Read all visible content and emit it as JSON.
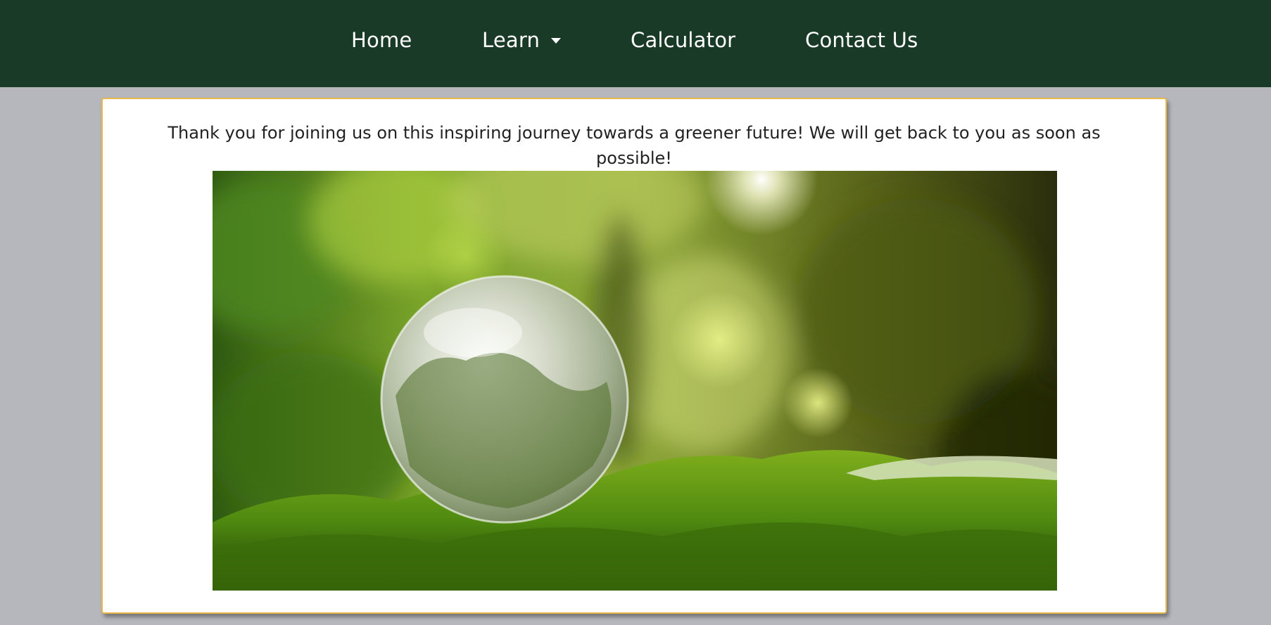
{
  "nav": {
    "items": [
      {
        "label": "Home"
      },
      {
        "label": "Learn",
        "has_dropdown": true
      },
      {
        "label": "Calculator"
      },
      {
        "label": "Contact Us"
      }
    ]
  },
  "main": {
    "message": "Thank you for joining us on this inspiring journey towards a greener future! We will get back to you as soon as possible!",
    "image": {
      "subject": "glass globe on green moss in forest",
      "overlay_icon": "visual-search-icon"
    }
  },
  "colors": {
    "nav_background": "#1a3a28",
    "page_background": "#b5b7bc",
    "card_border": "#e8b84a",
    "card_background": "#ffffff",
    "text": "#222222"
  }
}
